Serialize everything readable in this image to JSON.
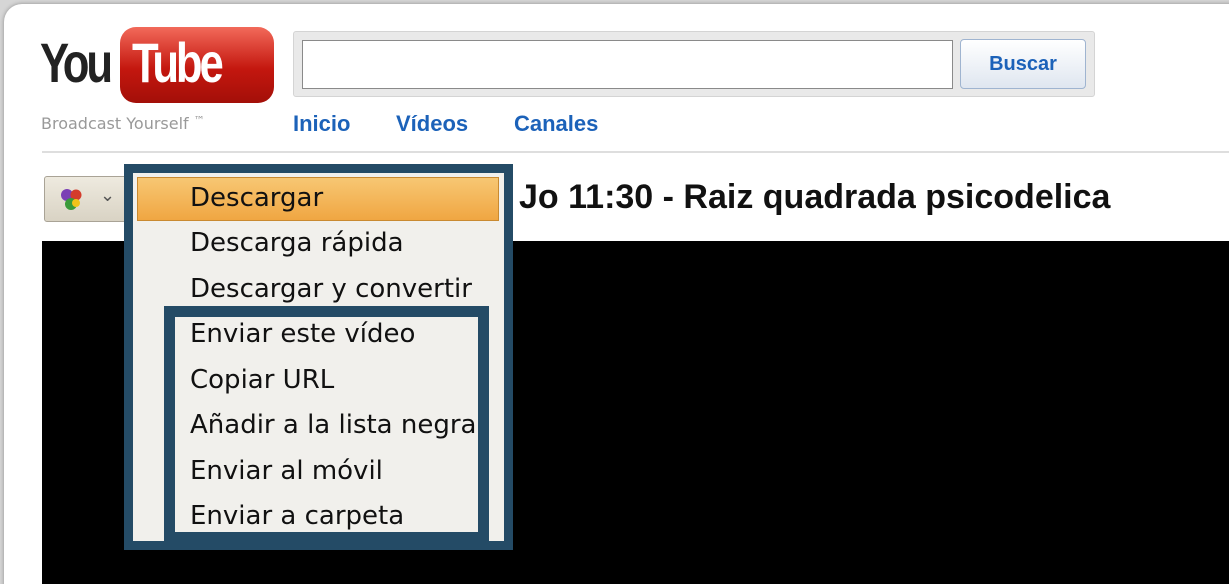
{
  "header": {
    "logo_you": "You",
    "logo_tube": "Tube",
    "tagline": "Broadcast Yourself",
    "tagline_tm": "™"
  },
  "search": {
    "value": "",
    "placeholder": "",
    "button_label": "Buscar"
  },
  "nav": {
    "items": [
      {
        "label": "Inicio"
      },
      {
        "label": "Vídeos"
      },
      {
        "label": "Canales"
      }
    ]
  },
  "extension": {
    "icon": "extension-balls-icon",
    "chevron": "⌄"
  },
  "video": {
    "title": "Jo 11:30 - Raiz quadrada psicodelica"
  },
  "menu": {
    "items": [
      {
        "label": "Descargar",
        "highlighted": true
      },
      {
        "label": "Descarga rápida"
      },
      {
        "label": "Descargar y convertir"
      },
      {
        "label": "Enviar este vídeo"
      },
      {
        "label": "Copiar URL"
      },
      {
        "label": "Añadir a la lista negra"
      },
      {
        "label": "Enviar al móvil"
      },
      {
        "label": "Enviar a carpeta"
      }
    ]
  },
  "colors": {
    "link": "#1c62b9",
    "frame": "#244b66",
    "highlight": "#f0a642",
    "logo_red": "#c4170f"
  }
}
